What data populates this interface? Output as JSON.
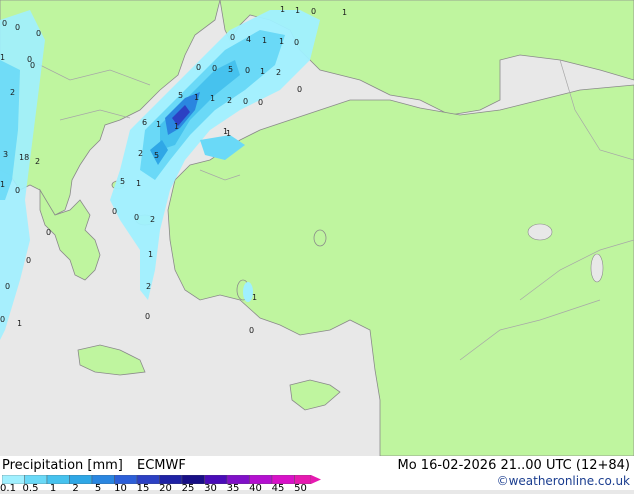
{
  "map": {
    "colors": {
      "sea": "#e8e8e8",
      "land": "#bff59f",
      "border": "#a7a7a7",
      "coast": "#8a8a8a"
    },
    "point_labels": [
      "1",
      "1",
      "0",
      "1",
      "0",
      "4",
      "1",
      "1",
      "0",
      "0",
      "0",
      "5",
      "0",
      "1",
      "2",
      "0",
      "5",
      "1",
      "1",
      "2",
      "0",
      "0",
      "6",
      "1",
      "1",
      "1",
      "2",
      "5",
      "3",
      "18",
      "2",
      "1",
      "0",
      "5",
      "1",
      "2",
      "0",
      "1",
      "0",
      "0",
      "1",
      "0",
      "1",
      "0",
      "0",
      "1",
      "0",
      "2",
      "0",
      "0",
      "0",
      "0",
      "2",
      "1",
      "0",
      "0"
    ]
  },
  "legend": {
    "title": "Precipitation [mm]",
    "model": "ECMWF",
    "valid": "Mo 16-02-2026 21..00 UTC (12+84)",
    "credit": "©weatheronline.co.uk",
    "ticks": [
      "0.1",
      "0.5",
      "1",
      "2",
      "5",
      "10",
      "15",
      "20",
      "25",
      "30",
      "35",
      "40",
      "45",
      "50"
    ],
    "colors": [
      "#a0f0ff",
      "#6ad9f7",
      "#46c2ee",
      "#2fa7e6",
      "#2a86e0",
      "#2d5fd8",
      "#2c40c3",
      "#1f22a5",
      "#180f86",
      "#4a0cb8",
      "#8010c8",
      "#b410d0",
      "#d812c8",
      "#e61ab0"
    ]
  }
}
